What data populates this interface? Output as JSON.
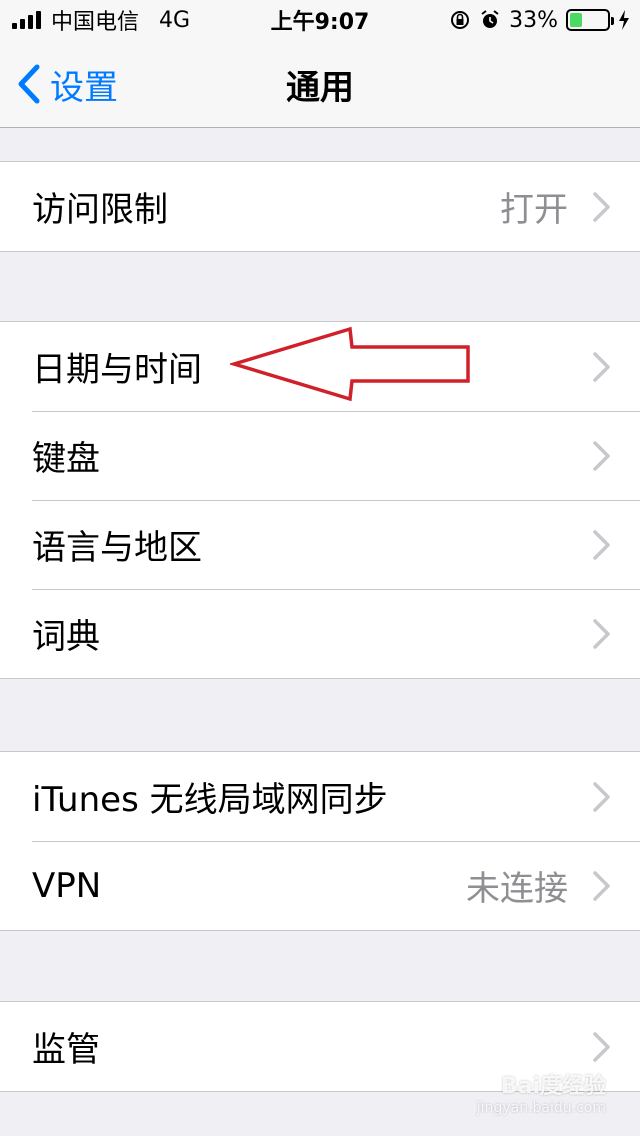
{
  "status_bar": {
    "carrier": "中国电信",
    "network": "4G",
    "time": "上午9:07",
    "battery_percent": "33%",
    "battery_level": 0.33,
    "battery_color": "#4cd964"
  },
  "nav": {
    "back_label": "设置",
    "title": "通用",
    "accent_color": "#007aff"
  },
  "groups": [
    {
      "rows": [
        {
          "label": "访问限制",
          "detail": "打开"
        }
      ]
    },
    {
      "rows": [
        {
          "label": "日期与时间"
        },
        {
          "label": "键盘"
        },
        {
          "label": "语言与地区"
        },
        {
          "label": "词典"
        }
      ]
    },
    {
      "rows": [
        {
          "label": "iTunes 无线局域网同步"
        },
        {
          "label": "VPN",
          "detail": "未连接"
        }
      ]
    },
    {
      "rows": [
        {
          "label": "监管"
        }
      ]
    }
  ],
  "annotation": {
    "color": "#d0202a",
    "target": "日期与时间"
  },
  "watermark": {
    "text": "Bai度经验",
    "sub": "jingyan.baidu.com"
  }
}
